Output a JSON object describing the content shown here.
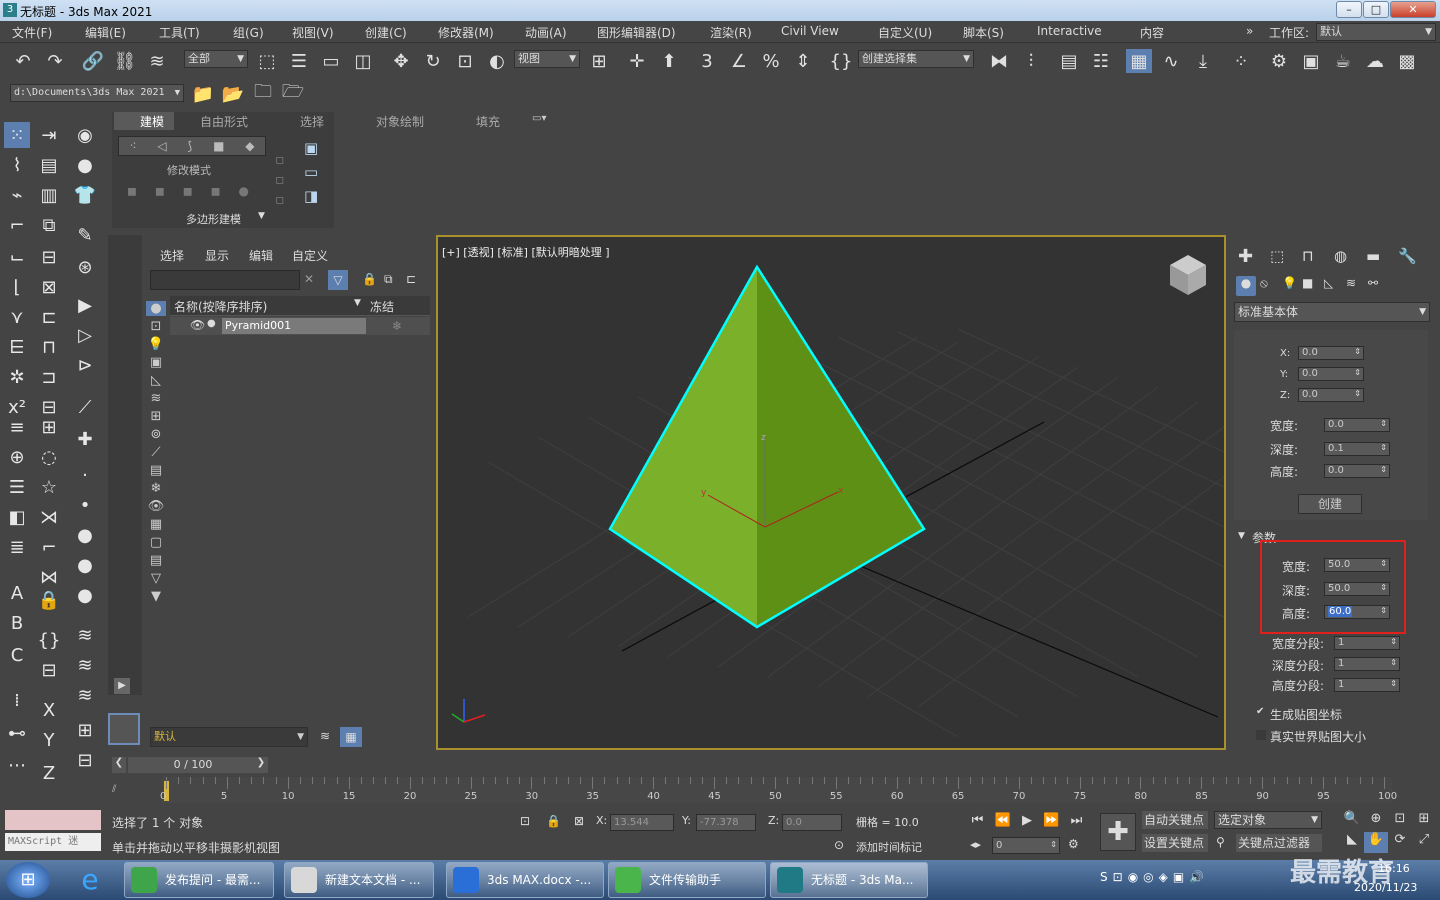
{
  "window": {
    "title": "无标题 - 3ds Max 2021",
    "app_icon": "3"
  },
  "menu": [
    "文件(F)",
    "编辑(E)",
    "工具(T)",
    "组(G)",
    "视图(V)",
    "创建(C)",
    "修改器(M)",
    "动画(A)",
    "图形编辑器(D)",
    "渲染(R)",
    "Civil View",
    "自定义(U)",
    "脚本(S)",
    "Interactive",
    "内容"
  ],
  "workspace": {
    "label": "工作区:",
    "value": "默认"
  },
  "toolbar": {
    "filter": "全部",
    "refcoord": "视图",
    "selset": "创建选择集"
  },
  "path": {
    "value": "d:\\Documents\\3ds Max 2021"
  },
  "ribbon": {
    "tabs": [
      "建模",
      "自由形式",
      "选择",
      "对象绘制",
      "填充"
    ],
    "mode": "修改模式",
    "poly": "多边形建模"
  },
  "scene": {
    "tabs": [
      "选择",
      "显示",
      "编辑",
      "自定义"
    ],
    "col_name": "名称(按降序排序)",
    "col_freeze": "冻结",
    "item": "Pyramid001",
    "layer": "默认"
  },
  "viewport": {
    "label": "[+] [透视] [标准] [默认明暗处理 ]",
    "axis_x": "x",
    "axis_y": "y",
    "axis_z": "z"
  },
  "cmd": {
    "category": "标准基本体",
    "kb": {
      "x_label": "X:",
      "x": "0.0",
      "y_label": "Y:",
      "y": "0.0",
      "z_label": "Z:",
      "z": "0.0",
      "w_label": "宽度:",
      "w": "0.0",
      "d_label": "深度:",
      "d": "0.1",
      "h_label": "高度:",
      "h": "0.0",
      "create": "创建"
    },
    "params": {
      "title": "参数",
      "w_label": "宽度:",
      "w": "50.0",
      "d_label": "深度:",
      "d": "50.0",
      "h_label": "高度:",
      "h": "60.0",
      "ws_label": "宽度分段:",
      "ws": "1",
      "ds_label": "深度分段:",
      "ds": "1",
      "hs_label": "高度分段:",
      "hs": "1",
      "gen": "生成贴图坐标",
      "real": "真实世界贴图大小"
    }
  },
  "timeline": {
    "frame": "0 / 100",
    "ticks": [
      "0",
      "5",
      "10",
      "15",
      "20",
      "25",
      "30",
      "35",
      "40",
      "45",
      "50",
      "55",
      "60",
      "65",
      "70",
      "75",
      "80",
      "85",
      "90",
      "95",
      "100"
    ]
  },
  "status": {
    "maxscript": "MAXScript 迷",
    "selected": "选择了 1 个 对象",
    "hint": "单击并拖动以平移非摄影机视图",
    "x_label": "X:",
    "x": "13.544",
    "y_label": "Y:",
    "y": "-77.378",
    "z_label": "Z:",
    "z": "0.0",
    "grid": "栅格 = 10.0",
    "addtime": "添加时间标记",
    "autokey": "自动关键点",
    "selobj": "选定对象",
    "setkey": "设置关键点",
    "keyfilter": "关键点过滤器",
    "frame": "0"
  },
  "taskbar": {
    "items": [
      "发布提问 - 最需...",
      "新建文本文档 - ...",
      "3ds MAX.docx -...",
      "文件传输助手",
      "无标题 - 3ds Ma..."
    ],
    "time": "16:16",
    "date": "2020/11/23",
    "watermark": "最需教育"
  },
  "colors": {
    "pyramid": "#7bb02a",
    "pyramid_dark": "#5e9015",
    "highlight": "#00ffff",
    "viewport_border": "#a8902c",
    "annotation": "#e0201c"
  }
}
